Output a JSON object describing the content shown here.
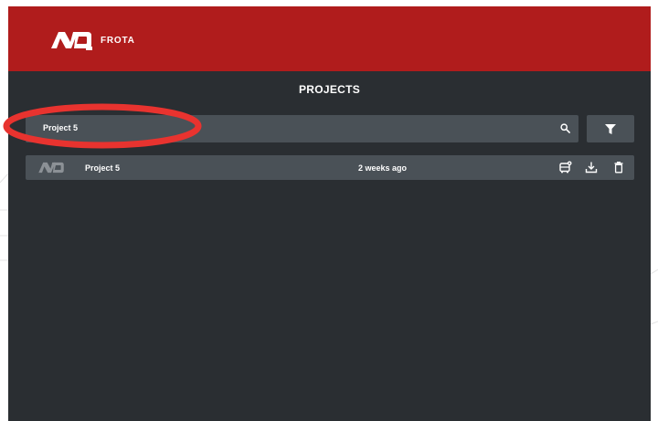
{
  "brand": {
    "name": "FROTA",
    "logo_icon": "nd-logo-icon"
  },
  "colors": {
    "header": "#b01c1c",
    "background": "#2a2e32",
    "surface": "#4a5157",
    "annotation": "#e8332f"
  },
  "page": {
    "title": "PROJECTS"
  },
  "search": {
    "value": "Project 5",
    "icon": "search-icon"
  },
  "filter": {
    "icon": "filter-icon"
  },
  "projects": [
    {
      "name": "Project 5",
      "updated": "2 weeks ago",
      "actions": [
        "bus-settings-icon",
        "download-icon",
        "delete-icon"
      ]
    }
  ]
}
